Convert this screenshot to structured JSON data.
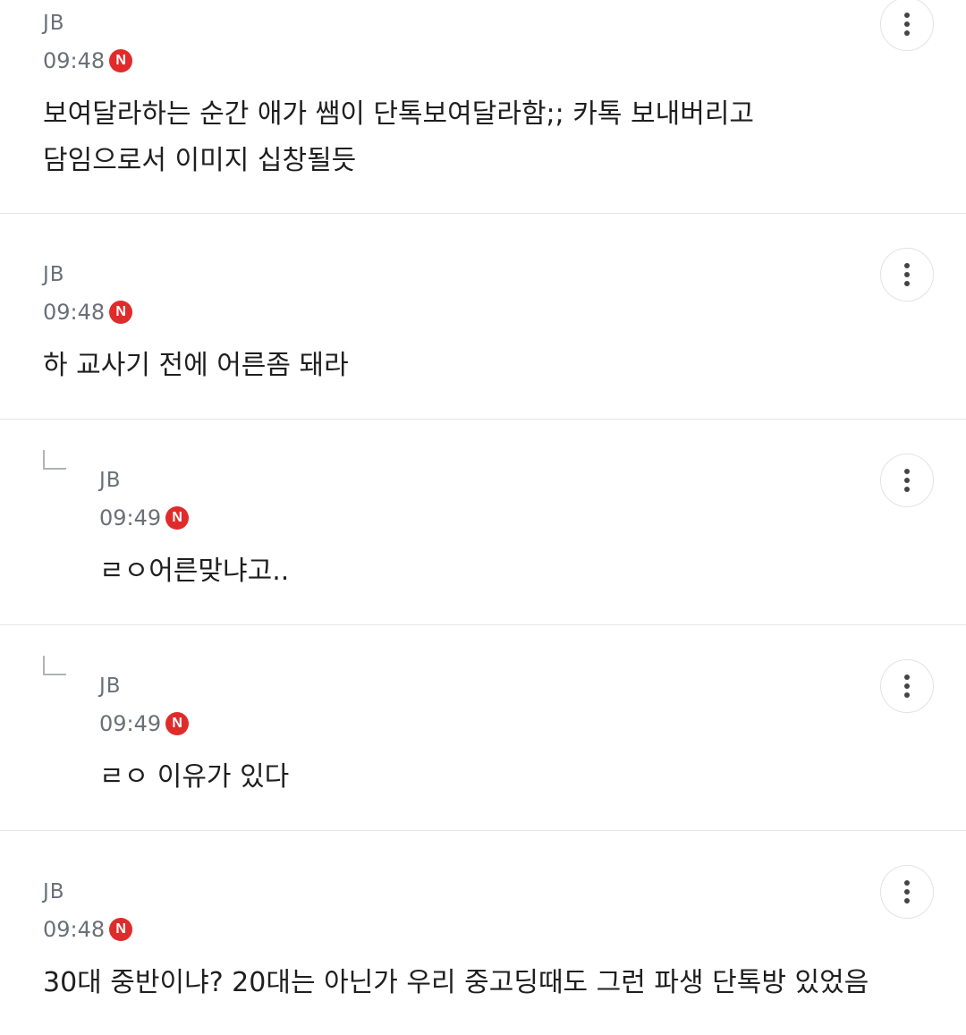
{
  "comments": [
    {
      "author": "JB",
      "time": "09:48",
      "badge": "N",
      "text": "보여달라하는 순간 애가 쌤이 단톡보여달라함;; 카톡 보내버리고\n담임으로서 이미지 십창될듯",
      "is_reply": false,
      "menu_icon": "more-vertical-icon"
    },
    {
      "author": "JB",
      "time": "09:48",
      "badge": "N",
      "text": "하 교사기 전에 어른좀 돼라",
      "is_reply": false,
      "menu_icon": "more-vertical-icon"
    },
    {
      "author": "JB",
      "time": "09:49",
      "badge": "N",
      "text": "ㄹㅇ어른맞냐고..",
      "is_reply": true,
      "menu_icon": "more-vertical-icon"
    },
    {
      "author": "JB",
      "time": "09:49",
      "badge": "N",
      "text": "ㄹㅇ 이유가 있다",
      "is_reply": true,
      "menu_icon": "more-vertical-icon"
    },
    {
      "author": "JB",
      "time": "09:48",
      "badge": "N",
      "text": "30대 중반이냐? 20대는 아닌가 우리 중고딩때도 그런 파생 단톡방 있었음",
      "is_reply": false,
      "menu_icon": "more-vertical-icon"
    }
  ],
  "colors": {
    "new_badge": "#e02b2b",
    "meta_text": "#6b6f78",
    "divider": "#e6e6e6"
  }
}
